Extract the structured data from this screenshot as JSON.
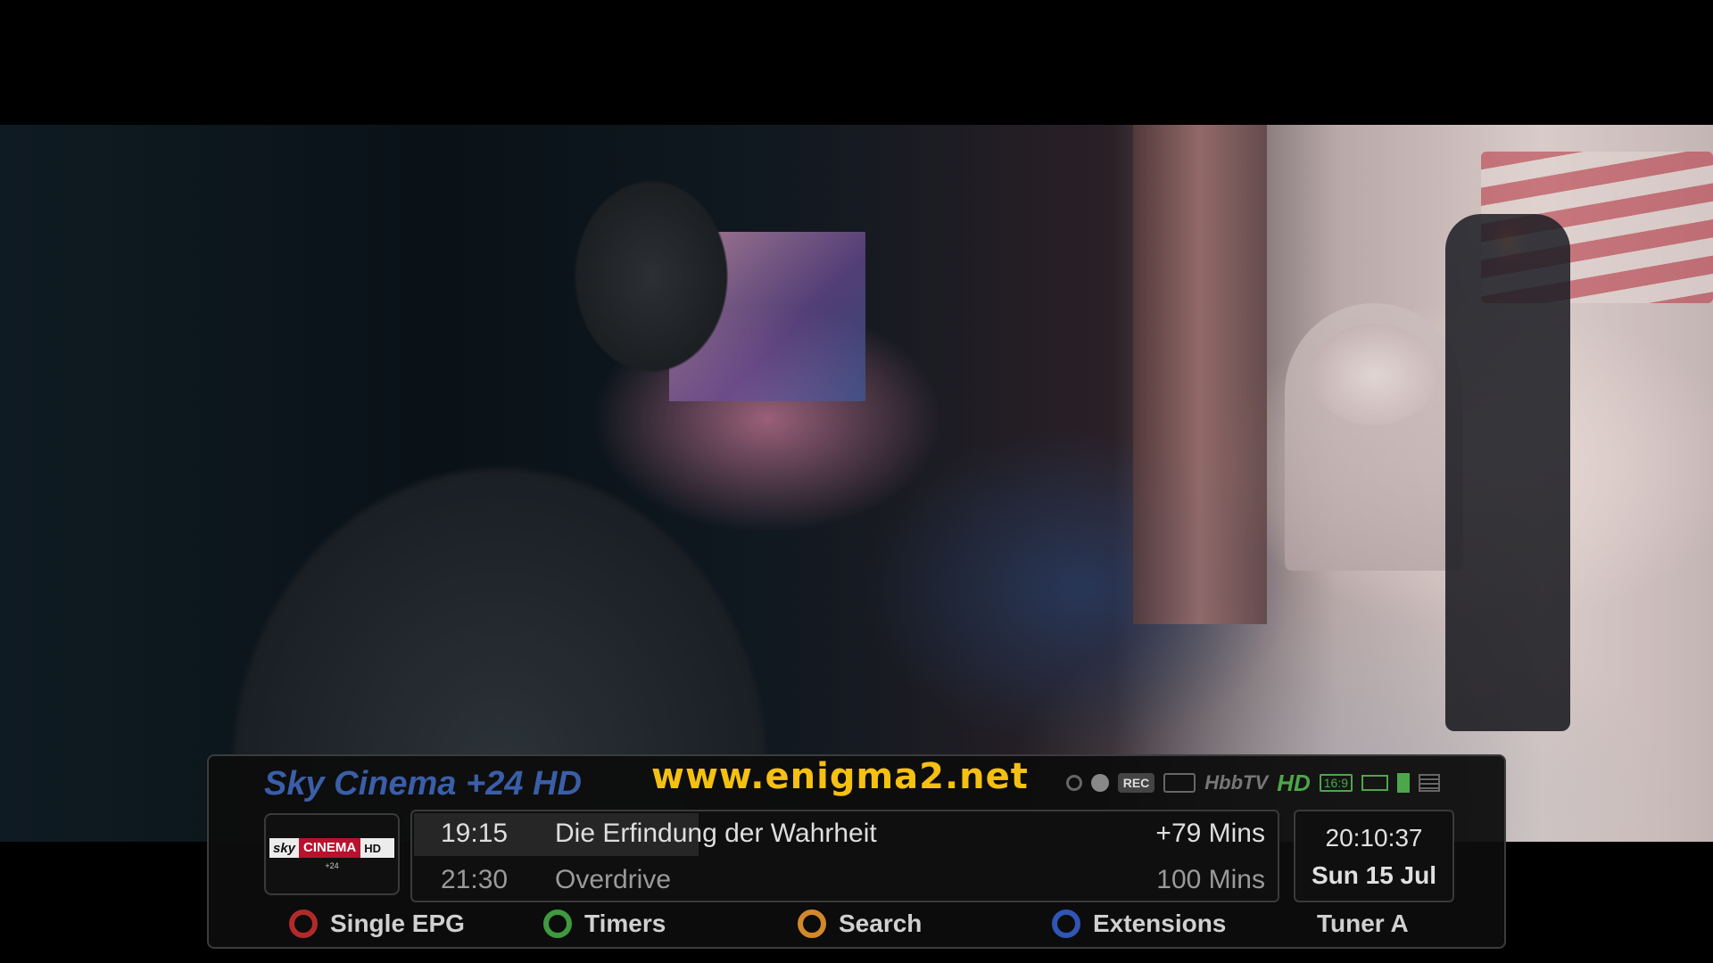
{
  "watermark": "www.enigma2.net",
  "channel": {
    "name": "Sky Cinema +24 HD",
    "logo": {
      "sky": "sky",
      "cinema": "CINEMA",
      "hd": "HD",
      "sub": "+24"
    }
  },
  "status_icons": [
    "audio-icon",
    "record-dot-icon",
    "REC",
    "tv-icon",
    "HbbTV",
    "HD",
    "16:9",
    "dolby-icon",
    "green-bar-icon",
    "teletext-icon"
  ],
  "status_labels": {
    "rec": "REC",
    "hbbtv": "HbbTV",
    "hd": "HD",
    "aspect": "16:9"
  },
  "epg": {
    "now": {
      "time": "19:15",
      "title": "Die Erfindung der Wahrheit",
      "duration": "+79 Mins",
      "progress": 0.33
    },
    "next": {
      "time": "21:30",
      "title": "Overdrive",
      "duration": "100 Mins"
    }
  },
  "clock": {
    "time": "20:10:37",
    "date": "Sun 15 Jul"
  },
  "buttons": [
    {
      "color": "#b12a2a",
      "label": "Single EPG"
    },
    {
      "color": "#3f9a3f",
      "label": "Timers"
    },
    {
      "color": "#d3882a",
      "label": "Search"
    },
    {
      "color": "#2f55b5",
      "label": "Extensions"
    }
  ],
  "tuner": "Tuner  A"
}
